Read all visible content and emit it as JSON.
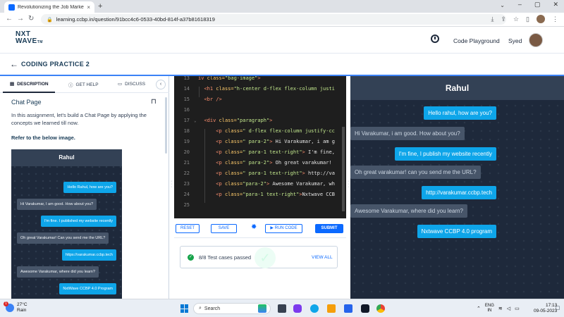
{
  "browser": {
    "tab_title": "Revolutionizing the Job Market |",
    "tab_close": "×",
    "new_tab": "+",
    "url": "learning.ccbp.in/question/91bcc4c6-0533-40bd-814f-a37b81618319"
  },
  "header": {
    "logo_line1": "NXT",
    "logo_line2": "WAVE",
    "logo_tm": "TM",
    "code_playground": "Code Playground",
    "user_name": "Syed"
  },
  "subheader": {
    "title": "CODING PRACTICE 2"
  },
  "left_panel": {
    "tabs": [
      {
        "label": "DESCRIPTION",
        "icon": "description-icon"
      },
      {
        "label": "GET HELP",
        "icon": "help-icon"
      },
      {
        "label": "DISCUSS",
        "icon": "discuss-icon"
      }
    ],
    "heading": "Chat Page",
    "description": "In this assignment, let's build a Chat Page by applying the concepts we learned till now.",
    "refer": "Refer to the below image."
  },
  "preview": {
    "title": "Rahul",
    "messages": [
      {
        "text": "Hello Rahul, how are you?",
        "side": "right"
      },
      {
        "text": "Hi Varakumar, I am good. How about you?",
        "side": "left"
      },
      {
        "text": "I'm fine. I published my website recently",
        "side": "right"
      },
      {
        "text": "Oh great Varakumar! Can you send me the URL?",
        "side": "left"
      },
      {
        "text": "https://varakumar.ccbp.tech",
        "side": "right"
      },
      {
        "text": "Awesome Varakumar, where did you learn?",
        "side": "left"
      },
      {
        "text": "NxtWave CCBP 4.0 Program",
        "side": "right"
      }
    ]
  },
  "editor": {
    "lines": [
      {
        "n": "13",
        "fold": "",
        "indent": "",
        "parts": [
          [
            "tag",
            "iv "
          ],
          [
            "attr",
            "class="
          ],
          [
            "str",
            "\"bag-image\""
          ],
          [
            "tag",
            ">"
          ]
        ]
      },
      {
        "n": "14",
        "fold": "",
        "indent": "  ",
        "parts": [
          [
            "tag",
            "<h1 "
          ],
          [
            "attr",
            "class="
          ],
          [
            "str",
            "\"h-center d-flex flex-column justi"
          ]
        ]
      },
      {
        "n": "15",
        "fold": "",
        "indent": "  ",
        "parts": [
          [
            "tag",
            "<br />"
          ]
        ]
      },
      {
        "n": "16",
        "fold": "",
        "indent": "",
        "parts": []
      },
      {
        "n": "17",
        "fold": "⌄",
        "indent": "  ",
        "parts": [
          [
            "tag",
            "<div "
          ],
          [
            "attr",
            "class="
          ],
          [
            "str",
            "\"paragraph\""
          ],
          [
            "tag",
            ">"
          ]
        ]
      },
      {
        "n": "18",
        "fold": "",
        "indent": "      ",
        "parts": [
          [
            "tag",
            "<p "
          ],
          [
            "attr",
            "class="
          ],
          [
            "str",
            "\" d-flex flex-column justify-cc"
          ]
        ]
      },
      {
        "n": "19",
        "fold": "",
        "indent": "      ",
        "parts": [
          [
            "tag",
            "<p "
          ],
          [
            "attr",
            "class="
          ],
          [
            "str",
            "\" para-2\""
          ],
          [
            "tag",
            "> "
          ],
          [
            "txt",
            "Hi Varakumar, i am g"
          ]
        ]
      },
      {
        "n": "20",
        "fold": "",
        "indent": "      ",
        "parts": [
          [
            "tag",
            "<p "
          ],
          [
            "attr",
            "class="
          ],
          [
            "str",
            "\" para-1 text-right\""
          ],
          [
            "tag",
            "> "
          ],
          [
            "txt",
            "I'm fine,"
          ]
        ]
      },
      {
        "n": "21",
        "fold": "",
        "indent": "      ",
        "parts": [
          [
            "tag",
            "<p "
          ],
          [
            "attr",
            "class="
          ],
          [
            "str",
            "\" para-2\""
          ],
          [
            "tag",
            "> "
          ],
          [
            "txt",
            "Oh great varakumar!"
          ]
        ]
      },
      {
        "n": "22",
        "fold": "",
        "indent": "      ",
        "parts": [
          [
            "tag",
            "<p "
          ],
          [
            "attr",
            "class="
          ],
          [
            "str",
            "\" para-1 text-right\""
          ],
          [
            "tag",
            "> "
          ],
          [
            "txt",
            "http://va"
          ]
        ]
      },
      {
        "n": "23",
        "fold": "",
        "indent": "      ",
        "parts": [
          [
            "tag",
            "<p "
          ],
          [
            "attr",
            "class="
          ],
          [
            "str",
            "\"para-2\""
          ],
          [
            "tag",
            "> "
          ],
          [
            "txt",
            "Awesome Varakumar, wh"
          ]
        ]
      },
      {
        "n": "24",
        "fold": "",
        "indent": "      ",
        "parts": [
          [
            "tag",
            "<p "
          ],
          [
            "attr",
            "class="
          ],
          [
            "str",
            "\"para-1 text-right\""
          ],
          [
            "tag",
            ">"
          ],
          [
            "txt",
            "Nxtwave CCB"
          ]
        ]
      },
      {
        "n": "25",
        "fold": "",
        "indent": "",
        "parts": []
      }
    ]
  },
  "toolbar": {
    "reset": "RESET",
    "save": "SAVE",
    "run_code": "▶ RUN CODE",
    "submit": "SUBMIT"
  },
  "results": {
    "passed_text": "8/8 Test cases passed",
    "view_all": "VIEW ALL"
  },
  "output": {
    "title": "Rahul",
    "messages": [
      {
        "text": "Hello rahul, how are you?",
        "side": "right"
      },
      {
        "text": "Hi Varakumar, i am good. How about you?",
        "side": "left"
      },
      {
        "text": "I'm fine, I publish my website recently",
        "side": "right"
      },
      {
        "text": "Oh great varakumar! can you send me the URL?",
        "side": "left"
      },
      {
        "text": "http://varakumar.ccbp.tech",
        "side": "right"
      },
      {
        "text": "Awesome Varakumar, where did you learn?",
        "side": "left"
      },
      {
        "text": "Nxtwave CCBP 4.0 program",
        "side": "right"
      }
    ]
  },
  "taskbar": {
    "temp": "27°C",
    "weather": "Rain",
    "weather_badge": "1",
    "search": "Search",
    "lang_line1": "ENG",
    "lang_line2": "IN",
    "time": "17:13",
    "date": "09-05-2023"
  },
  "colors": {
    "accent": "#0b69ff",
    "chat_bg": "#1e293b",
    "bubble_right": "#0ea5e9",
    "bubble_left": "#475569",
    "success": "#16a34a"
  }
}
